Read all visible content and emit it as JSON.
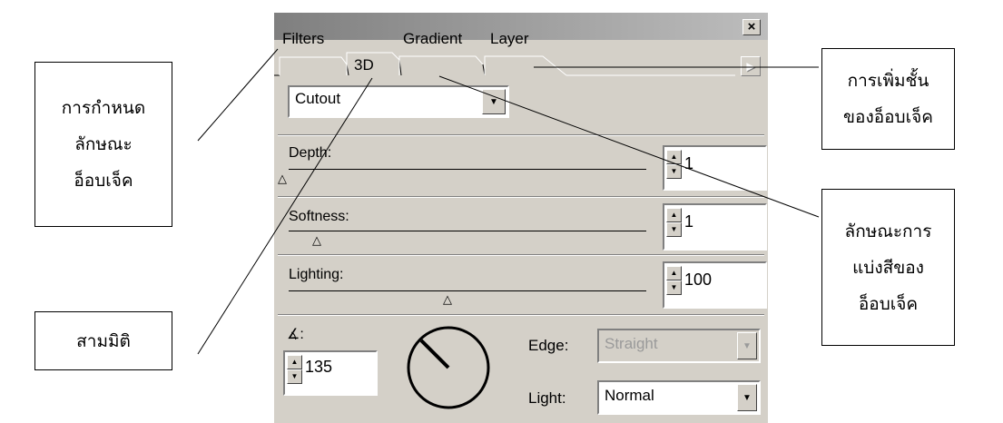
{
  "callouts": {
    "object_style": [
      "การกำหนด",
      "ลักษณะ",
      "อ็อบเจ็ค"
    ],
    "three_d": [
      "สามมิติ"
    ],
    "add_layer": [
      "การเพิ่มชั้น",
      "ของอ็อบเจ็ค"
    ],
    "color_division": [
      "ลักษณะการ",
      "แบ่งสีของ",
      "อ็อบเจ็ค"
    ]
  },
  "panel": {
    "close_glyph": "×",
    "scroll_glyph": "▶",
    "tabs": [
      {
        "label": "Filters"
      },
      {
        "label": "3D"
      },
      {
        "label": "Gradient"
      },
      {
        "label": "Layer"
      }
    ],
    "preset": {
      "value": "Cutout",
      "arrow": "▼"
    },
    "depth": {
      "label": "Depth:",
      "value": "1",
      "level": 0.0
    },
    "softness": {
      "label": "Softness:",
      "value": "1",
      "level": 0.1
    },
    "lighting": {
      "label": "Lighting:",
      "value": "100",
      "level": 0.45
    },
    "angle": {
      "icon": "angle-icon",
      "label": "∡:",
      "value": "135"
    },
    "edge": {
      "label": "Edge:",
      "value": "Straight",
      "arrow": "▼"
    },
    "light": {
      "label": "Light:",
      "value": "Normal",
      "arrow": "▼"
    },
    "spin_up": "▲",
    "spin_down": "▼",
    "thumb_glyph": "△"
  }
}
